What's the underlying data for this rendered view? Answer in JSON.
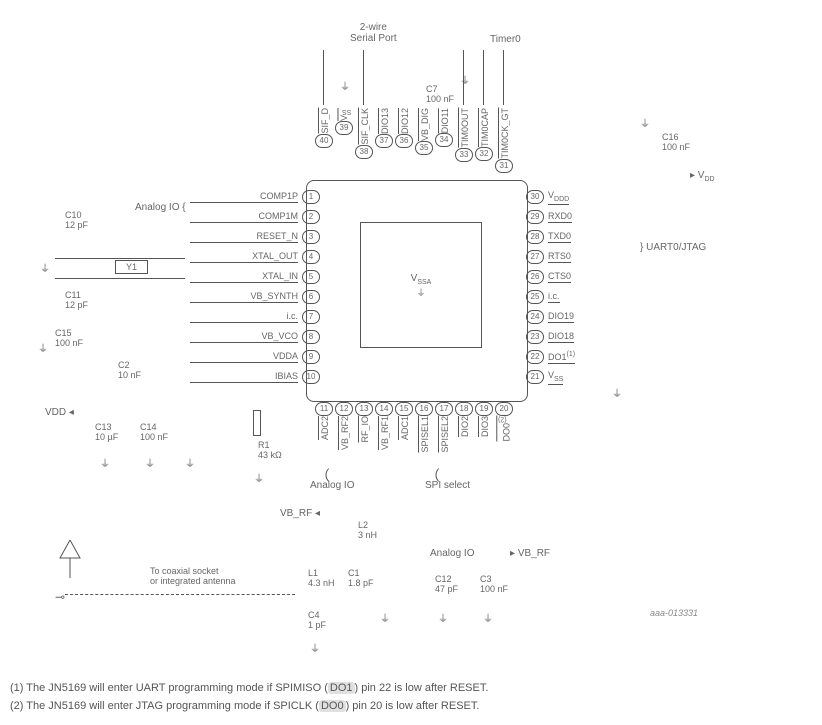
{
  "headers": {
    "serial_port": "2-wire\nSerial Port",
    "timer0": "Timer0",
    "analog_io_left": "Analog IO",
    "uart_jtag": "UART0/JTAG",
    "analog_io_bottom1": "Analog IO",
    "spi_select": "SPI select",
    "analog_io_bottom2": "Analog IO",
    "vb_rf_left": "VB_RF",
    "vb_rf_right": "VB_RF",
    "vdd_left": "VDD",
    "vdd_right": "VDD",
    "vssa": "VSSA"
  },
  "pins_left": [
    {
      "n": "1",
      "lbl": "COMP1P"
    },
    {
      "n": "2",
      "lbl": "COMP1M"
    },
    {
      "n": "3",
      "lbl": "RESET_N"
    },
    {
      "n": "4",
      "lbl": "XTAL_OUT"
    },
    {
      "n": "5",
      "lbl": "XTAL_IN"
    },
    {
      "n": "6",
      "lbl": "VB_SYNTH"
    },
    {
      "n": "7",
      "lbl": "i.c."
    },
    {
      "n": "8",
      "lbl": "VB_VCO"
    },
    {
      "n": "9",
      "lbl": "VDDA"
    },
    {
      "n": "10",
      "lbl": "IBIAS"
    }
  ],
  "pins_bottom": [
    {
      "n": "11",
      "lbl": "ADC2"
    },
    {
      "n": "12",
      "lbl": "VB_RF2"
    },
    {
      "n": "13",
      "lbl": "RF_IO"
    },
    {
      "n": "14",
      "lbl": "VB_RF1"
    },
    {
      "n": "15",
      "lbl": "ADC1"
    },
    {
      "n": "16",
      "lbl": "SPISEL1"
    },
    {
      "n": "17",
      "lbl": "SPISEL2"
    },
    {
      "n": "18",
      "lbl": "DIO2"
    },
    {
      "n": "19",
      "lbl": "DIO3"
    },
    {
      "n": "20",
      "lbl": "DO0(2)"
    }
  ],
  "pins_right": [
    {
      "n": "30",
      "lbl": "VDDD"
    },
    {
      "n": "29",
      "lbl": "RXD0"
    },
    {
      "n": "28",
      "lbl": "TXD0"
    },
    {
      "n": "27",
      "lbl": "RTS0"
    },
    {
      "n": "26",
      "lbl": "CTS0"
    },
    {
      "n": "25",
      "lbl": "i.c."
    },
    {
      "n": "24",
      "lbl": "DIO19"
    },
    {
      "n": "23",
      "lbl": "DIO18"
    },
    {
      "n": "22",
      "lbl": "DO1(1)"
    },
    {
      "n": "21",
      "lbl": "VSS"
    }
  ],
  "pins_top": [
    {
      "n": "40",
      "lbl": "SIF_D"
    },
    {
      "n": "39",
      "lbl": "VSS"
    },
    {
      "n": "38",
      "lbl": "SIF_CLK"
    },
    {
      "n": "37",
      "lbl": "DIO13"
    },
    {
      "n": "36",
      "lbl": "DIO12"
    },
    {
      "n": "35",
      "lbl": "VB_DIG"
    },
    {
      "n": "34",
      "lbl": "DIO11"
    },
    {
      "n": "33",
      "lbl": "TIM0OUT"
    },
    {
      "n": "32",
      "lbl": "TIM0CAP"
    },
    {
      "n": "31",
      "lbl": "TIM0CK_GT"
    }
  ],
  "components": {
    "c7": {
      "name": "C7",
      "val": "100 nF"
    },
    "c10": {
      "name": "C10",
      "val": "12 pF"
    },
    "c11": {
      "name": "C11",
      "val": "12 pF"
    },
    "c15": {
      "name": "C15",
      "val": "100 nF"
    },
    "c2": {
      "name": "C2",
      "val": "10 nF"
    },
    "c13": {
      "name": "C13",
      "val": "10 µF"
    },
    "c14": {
      "name": "C14",
      "val": "100 nF"
    },
    "c16": {
      "name": "C16",
      "val": "100 nF"
    },
    "c12": {
      "name": "C12",
      "val": "47 pF"
    },
    "c3": {
      "name": "C3",
      "val": "100 nF"
    },
    "c4": {
      "name": "C4",
      "val": "1 pF"
    },
    "c1": {
      "name": "C1",
      "val": "1.8 pF"
    },
    "r1": {
      "name": "R1",
      "val": "43 kΩ"
    },
    "y1": {
      "name": "Y1"
    },
    "l1": {
      "name": "L1",
      "val": "4.3 nH"
    },
    "l2": {
      "name": "L2",
      "val": "3 nH"
    },
    "antenna_note": "To coaxial socket\nor integrated antenna"
  },
  "docnum": "aaa-013331",
  "footnotes": {
    "f1_prefix": "(1)   The JN5169 will enter UART programming mode if SPIMISO (",
    "f1_hl": "DO1",
    "f1_suffix": ") pin 22 is low after RESET.",
    "f2_prefix": "(2)   The JN5169 will enter JTAG programming mode if SPICLK (",
    "f2_hl": "DO0",
    "f2_suffix": ") pin 20 is low after RESET."
  }
}
